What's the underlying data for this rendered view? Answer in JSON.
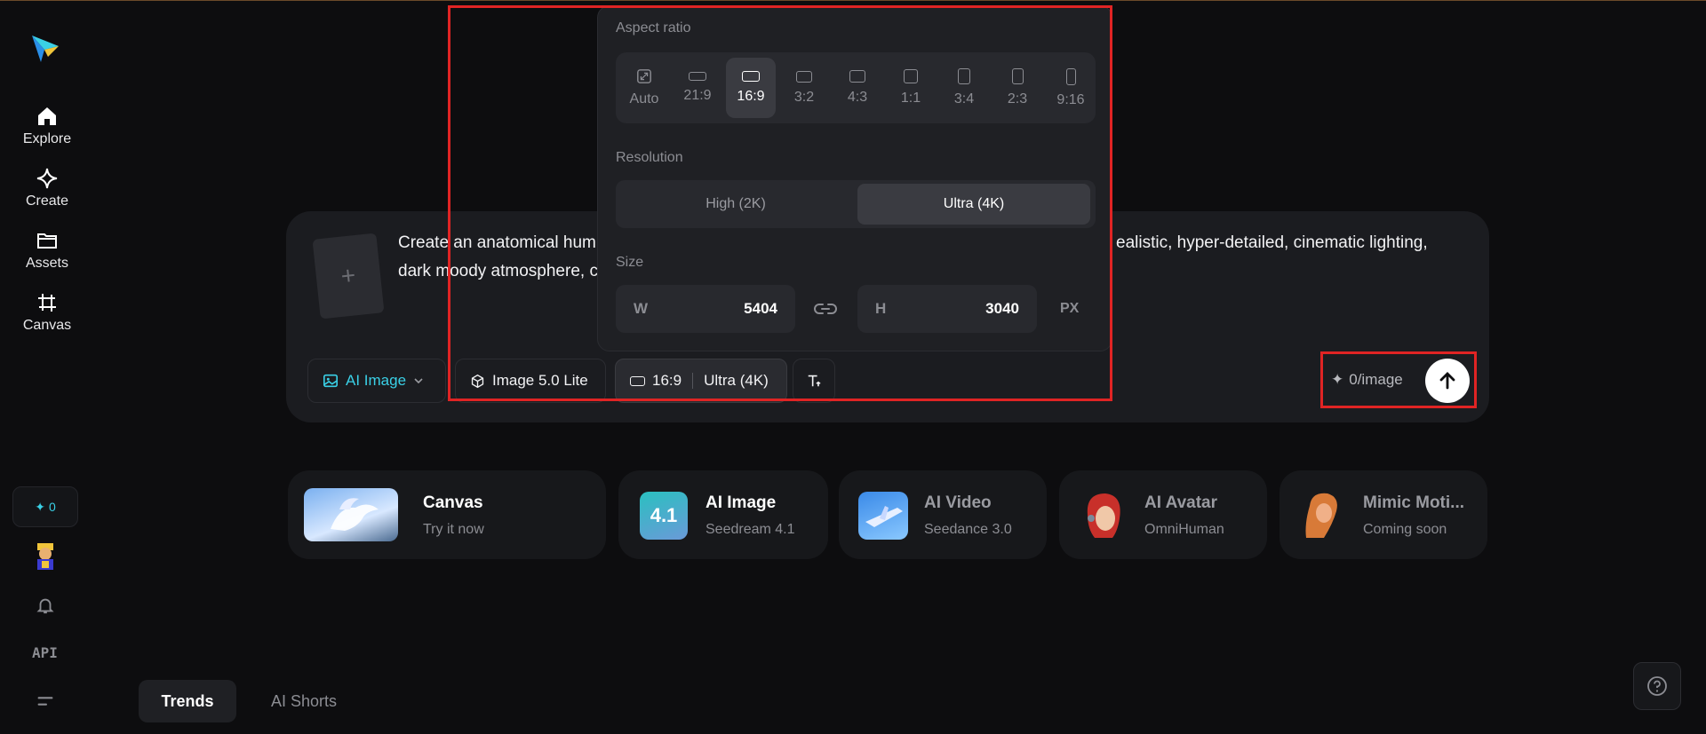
{
  "sidebar": {
    "items": [
      {
        "label": "Explore",
        "icon": "home-icon"
      },
      {
        "label": "Create",
        "icon": "diamond-icon"
      },
      {
        "label": "Assets",
        "icon": "folder-icon"
      },
      {
        "label": "Canvas",
        "icon": "crop-icon"
      }
    ],
    "credits": "0",
    "api_label": "API"
  },
  "prompt": {
    "text_line1": "Create an anatomical hum",
    "text_line1_end": "ealistic, hyper-detailed, cinematic lighting,",
    "text_line2": "dark moody atmosphere, c",
    "add_symbol": "+"
  },
  "toolbar": {
    "mode_label": "AI Image",
    "model_label": "Image 5.0 Lite",
    "ratio_label": "16:9",
    "resolution_label": "Ultra (4K)",
    "cost_label": "0/image"
  },
  "panel": {
    "aspect_title": "Aspect ratio",
    "aspect_options": [
      "Auto",
      "21:9",
      "16:9",
      "3:2",
      "4:3",
      "1:1",
      "3:4",
      "2:3",
      "9:16"
    ],
    "selected_aspect": "16:9",
    "resolution_title": "Resolution",
    "resolution_options": [
      "High (2K)",
      "Ultra (4K)"
    ],
    "selected_resolution": "Ultra (4K)",
    "size_title": "Size",
    "width_key": "W",
    "width_value": "5404",
    "height_key": "H",
    "height_value": "3040",
    "unit": "PX"
  },
  "features": [
    {
      "title": "Canvas",
      "subtitle": "Try it now"
    },
    {
      "title": "AI Image",
      "subtitle": "Seedream 4.1",
      "badge": "4.1"
    },
    {
      "title": "AI Video",
      "subtitle": "Seedance 3.0"
    },
    {
      "title": "AI Avatar",
      "subtitle": "OmniHuman"
    },
    {
      "title": "Mimic Moti...",
      "subtitle": "Coming soon"
    }
  ],
  "tabs": [
    "Trends",
    "AI Shorts"
  ],
  "colors": {
    "accent": "#3ad0e6",
    "annotation": "#e02424",
    "background": "#0d0d0f"
  }
}
